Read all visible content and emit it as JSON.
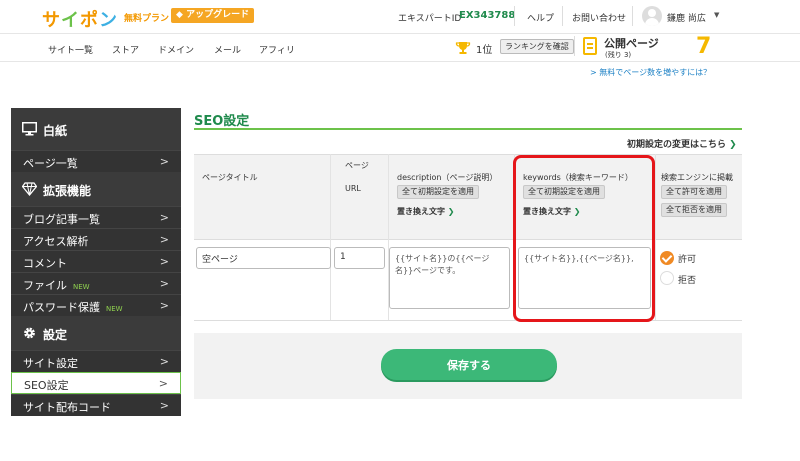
{
  "header": {
    "logo": [
      "サ",
      "イ",
      "ポ",
      "ン"
    ],
    "plan": "無料プラン",
    "upgrade": "アップグレード",
    "expert_label": "エキスパートID",
    "expert_id": "EX343788",
    "help": "ヘルプ",
    "contact": "お問い合わせ",
    "username": "鎌鹿 尚広",
    "caret": "▼"
  },
  "nav": {
    "items": [
      "サイト一覧",
      "ストア",
      "ドメイン",
      "メール",
      "アフィリ"
    ],
    "rank": "1位",
    "rank_button": "ランキングを確認",
    "public_label": "公開ページ",
    "public_remain": "(残り 3)",
    "public_count": "7",
    "more_link": "> 無料でページ数を増やすには？"
  },
  "sidebar": {
    "section1": "白紙",
    "page_list": "ページ一覧",
    "section2": "拡張機能",
    "ext_items": [
      "ブログ記事一覧",
      "アクセス解析",
      "コメント",
      "ファイル",
      "パスワード保護"
    ],
    "new_badge": "NEW",
    "section3": "設定",
    "setting_items": [
      "サイト設定",
      "SEO設定",
      "サイト配布コード"
    ],
    "chevron": ">"
  },
  "main": {
    "title": "SEO設定",
    "reset_link": "初期設定の変更はこちら",
    "columns": {
      "page_title": "ページタイトル",
      "page_url_1": "ページ",
      "page_url_2": "URL",
      "description": "description（ページ説明）",
      "keywords": "keywords（検索キーワード）",
      "search_engine": "検索エンジンに掲載"
    },
    "apply_all_initial": "全て初期設定を適用",
    "replace_text": "置き換え文字",
    "allow_all": "全て許可を適用",
    "deny_all": "全て拒否を適用",
    "row": {
      "title_value": "空ページ",
      "url_value": "1",
      "description_value": "{{サイト名}}の{{ページ名}}ページです。",
      "keywords_value": "{{サイト名}},{{ページ名}},",
      "allow": "許可",
      "deny": "拒否"
    },
    "save": "保存する"
  },
  "colors": {
    "brand_green": "#1f8a4c",
    "accent_orange": "#f39800",
    "highlight_red": "#e5161a",
    "save_green": "#3cb878"
  }
}
